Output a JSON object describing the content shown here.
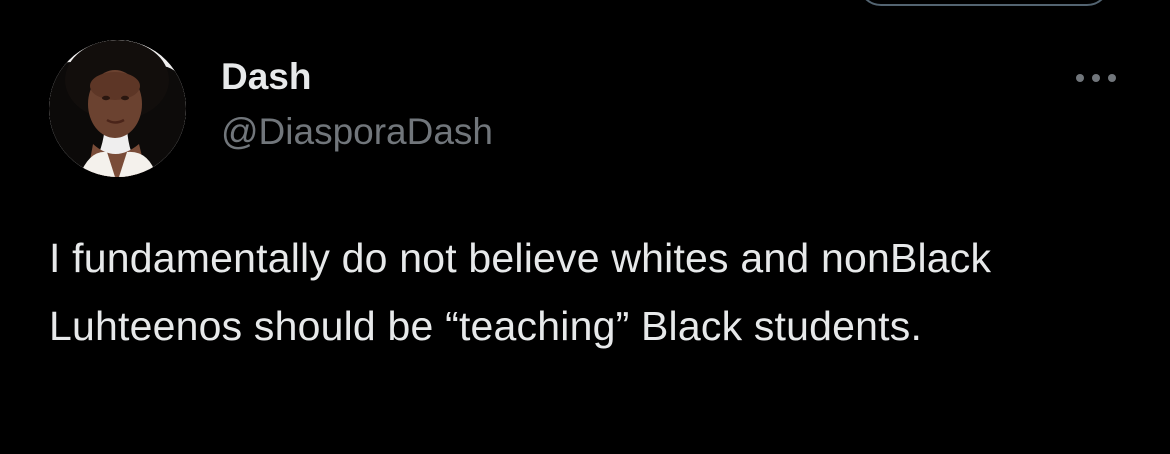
{
  "tweet": {
    "author": {
      "display_name": "Dash",
      "handle": "@DiasporaDash",
      "avatar_icon": "profile-photo"
    },
    "more_icon": "more-horizontal-icon",
    "text": "I fundamentally do not believe whites and nonBlack Luhteenos should be “teaching” Black students."
  },
  "colors": {
    "background": "#000000",
    "primary_text": "#e7e9ea",
    "secondary_text": "#71767b",
    "border": "#536471"
  }
}
